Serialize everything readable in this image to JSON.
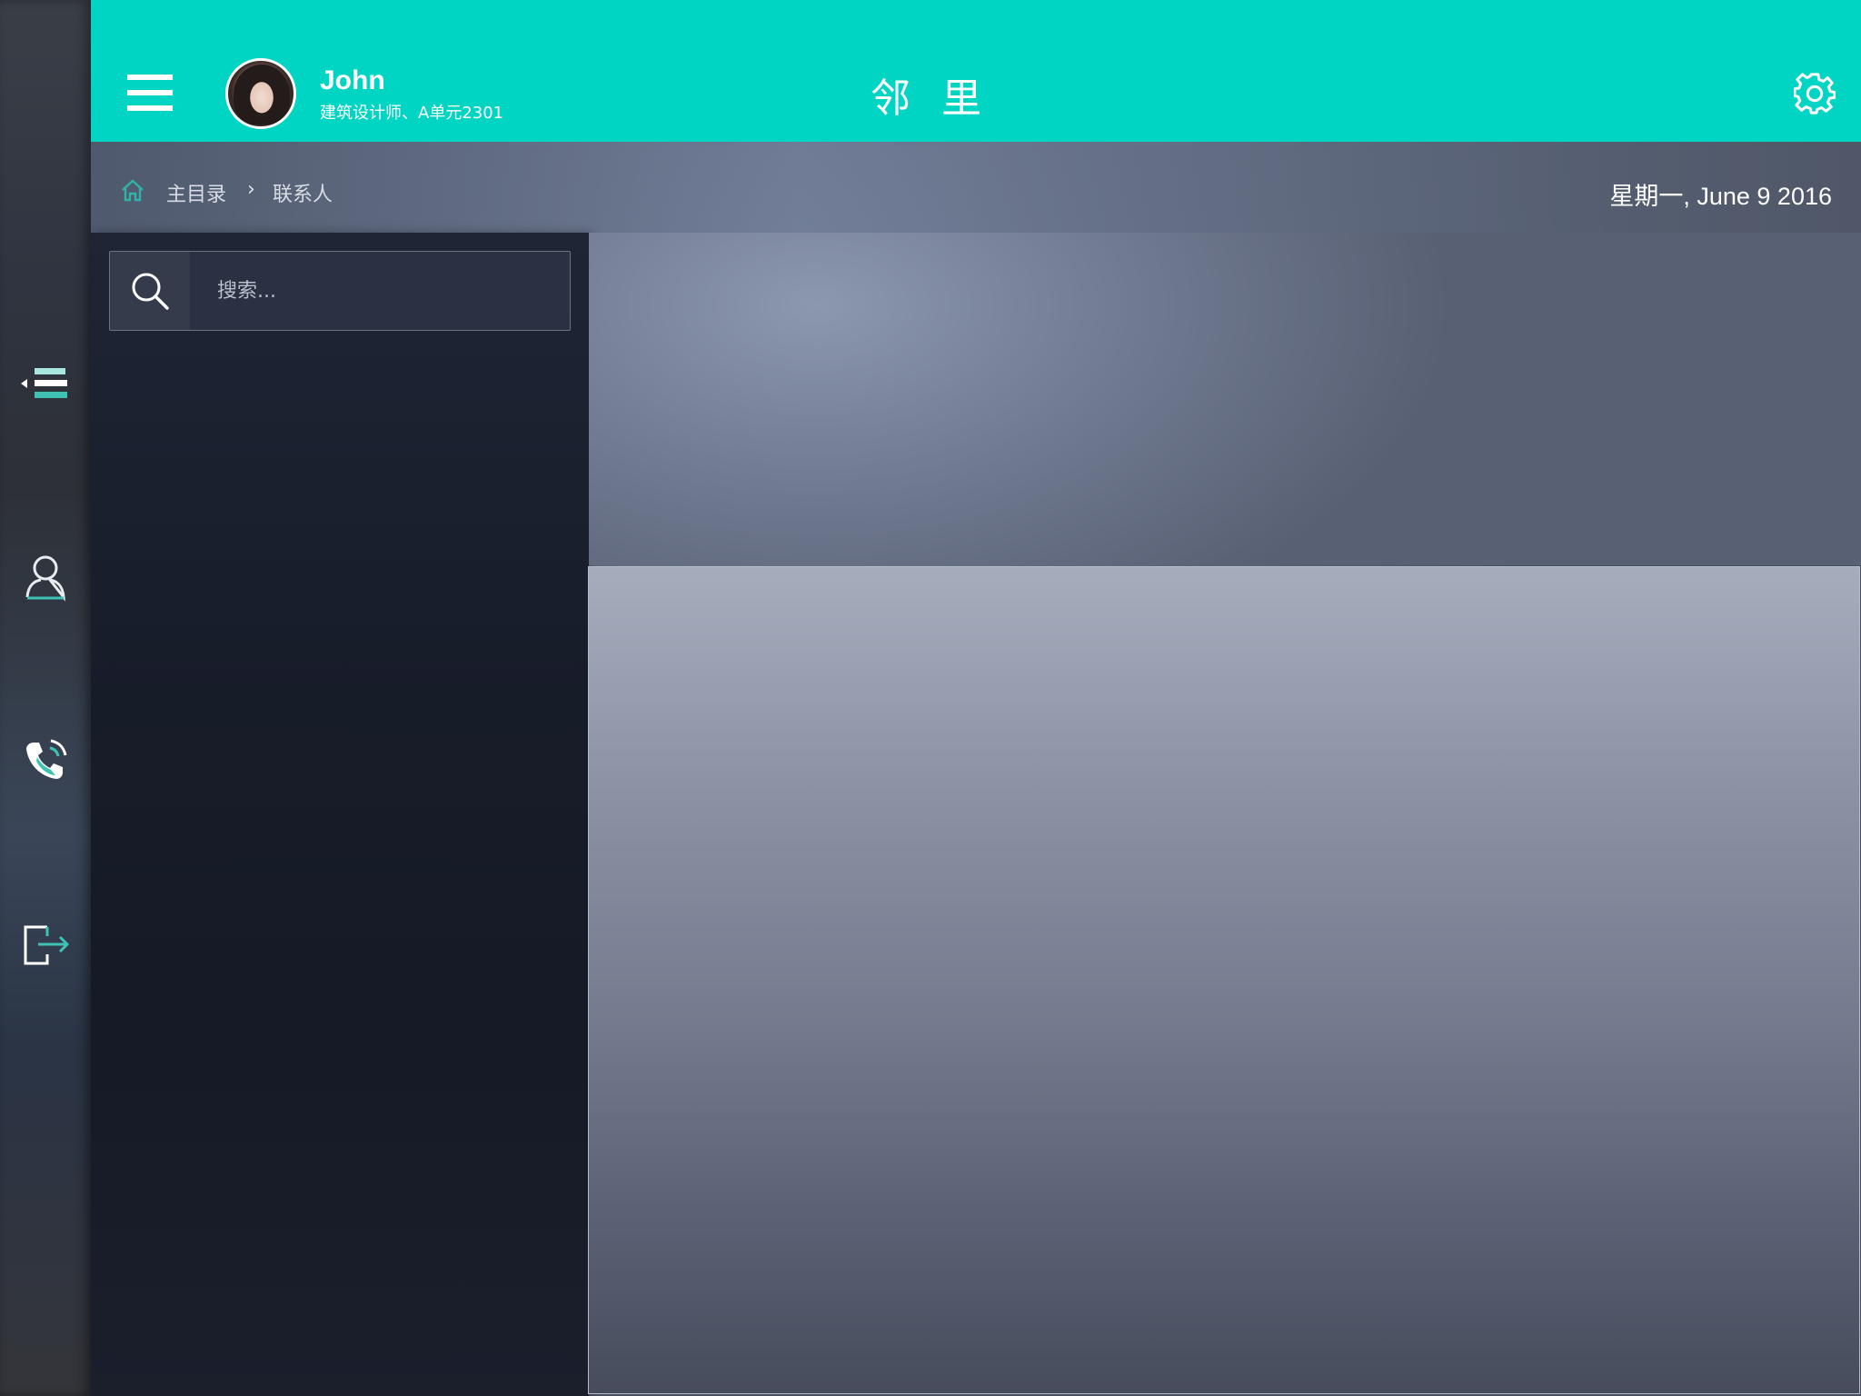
{
  "header": {
    "title": "邻 里",
    "user": {
      "name": "John",
      "description": "建筑设计师、A单元2301"
    }
  },
  "breadcrumb": {
    "items": [
      "主目录",
      "联系人"
    ],
    "separator": "›"
  },
  "date": "星期一, June 9  2016",
  "search": {
    "placeholder": "搜索...",
    "value": ""
  },
  "rail": {
    "items": [
      "menu-collapse",
      "contacts",
      "phone",
      "logout"
    ]
  },
  "colors": {
    "accent": "#00d5c4",
    "panel": "#1a1f2c",
    "text": "#ffffff"
  }
}
